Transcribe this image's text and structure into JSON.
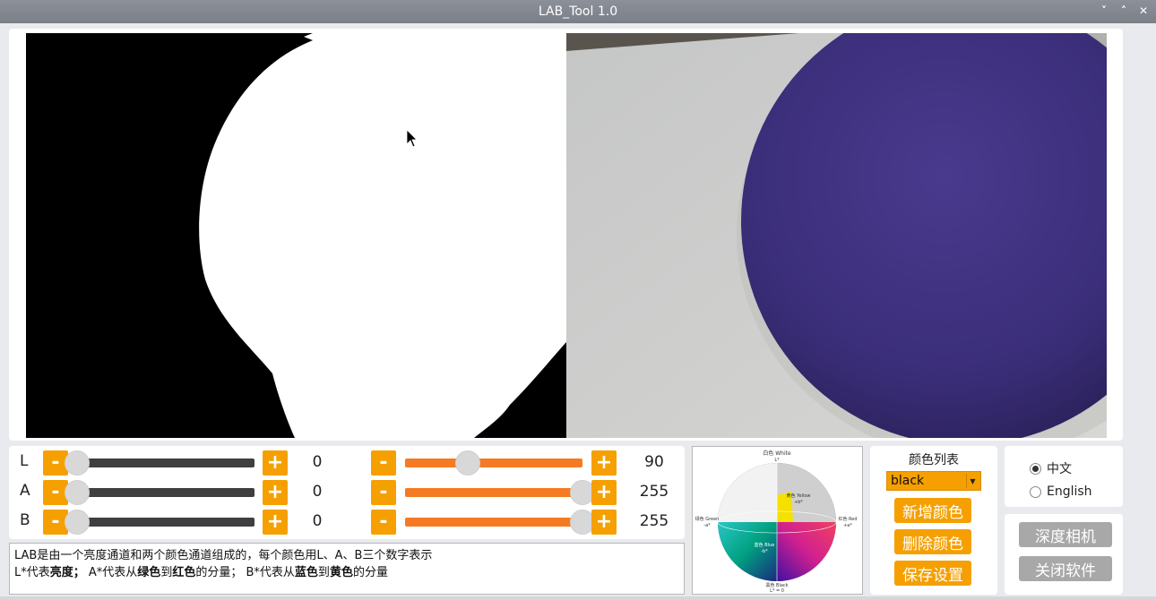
{
  "window": {
    "title": "LAB_Tool 1.0",
    "controls": [
      "˅",
      "˄",
      "✕"
    ]
  },
  "sliders": {
    "minus": "-",
    "plus": "+",
    "rows": [
      {
        "label": "L",
        "min_value": "0",
        "max_value": "90"
      },
      {
        "label": "A",
        "min_value": "0",
        "max_value": "255"
      },
      {
        "label": "B",
        "min_value": "0",
        "max_value": "255"
      }
    ],
    "min_fraction": [
      0.0,
      0.0,
      0.0
    ],
    "max_fraction": [
      0.3529,
      1.0,
      1.0
    ]
  },
  "description": {
    "line1": "LAB是由一个亮度通道和两个颜色通道组成的，每个颜色用L、A、B三个数字表示",
    "line2_a": "L*代表",
    "line2_b": "亮度；",
    "line2_c": "  A*代表从",
    "line2_d": "绿色",
    "line2_e": "到",
    "line2_f": "红色",
    "line2_g": "的分量；  B*代表从",
    "line2_h": "蓝色",
    "line2_i": "到",
    "line2_j": "黄色",
    "line2_k": "的分量"
  },
  "lab_diagram": {
    "top_label": "白色 White",
    "top_sub": "L*",
    "left_label": "绿色 Green",
    "left_sub": "-a*",
    "right_label": "红色 Red",
    "right_sub": "+a*",
    "yellow_label": "黄色 Yellow",
    "yellow_sub": "+b*",
    "blue_label": "蓝色 Blue",
    "blue_sub": "-b*",
    "bottom_label": "黑色 Black",
    "bottom_sub": "L* = 0"
  },
  "color_list": {
    "title": "颜色列表",
    "selected": "black",
    "add_button": "新增颜色",
    "delete_button": "删除颜色",
    "save_button": "保存设置"
  },
  "language": {
    "options": [
      "中文",
      "English"
    ],
    "selected_index": 0
  },
  "system": {
    "depth_camera_button": "深度相机",
    "close_button": "关闭软件"
  },
  "colors": {
    "accent": "#f5a000",
    "slider_max": "#f57a24",
    "slider_min": "#3f3f3f",
    "gray_button": "#a8a8a8",
    "ball": "#3f3180"
  }
}
